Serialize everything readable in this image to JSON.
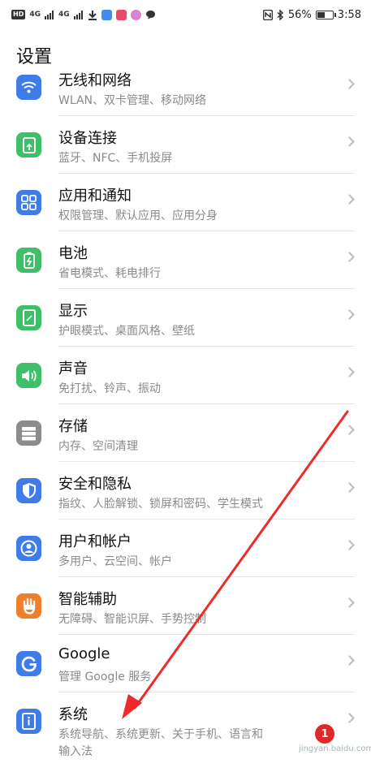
{
  "statusbar": {
    "left_chip": "HD",
    "net1": "4G",
    "net2": "4G",
    "battery": "56%",
    "time": "3:58",
    "battery_fraction": 0.56
  },
  "page": {
    "title": "设置"
  },
  "items": [
    {
      "title": "无线和网络",
      "subtitle": "WLAN、双卡管理、移动网络",
      "icon": "wifi-icon",
      "color": "#3f7ce8"
    },
    {
      "title": "设备连接",
      "subtitle": "蓝牙、NFC、手机投屏",
      "icon": "device-connect-icon",
      "color": "#3fbf6a"
    },
    {
      "title": "应用和通知",
      "subtitle": "权限管理、默认应用、应用分身",
      "icon": "apps-icon",
      "color": "#3f7ce8"
    },
    {
      "title": "电池",
      "subtitle": "省电模式、耗电排行",
      "icon": "battery-icon",
      "color": "#3fbf6a"
    },
    {
      "title": "显示",
      "subtitle": "护眼模式、桌面风格、壁纸",
      "icon": "display-icon",
      "color": "#3fbf6a"
    },
    {
      "title": "声音",
      "subtitle": "免打扰、铃声、振动",
      "icon": "sound-icon",
      "color": "#3fbf6a"
    },
    {
      "title": "存储",
      "subtitle": "内存、空间清理",
      "icon": "storage-icon",
      "color": "#8c8c8c"
    },
    {
      "title": "安全和隐私",
      "subtitle": "指纹、人脸解锁、锁屏和密码、学生模式",
      "icon": "shield-icon",
      "color": "#3f7ce8"
    },
    {
      "title": "用户和帐户",
      "subtitle": "多用户、云空间、帐户",
      "icon": "user-icon",
      "color": "#3f7ce8"
    },
    {
      "title": "智能辅助",
      "subtitle": "无障碍、智能识屏、手势控制",
      "icon": "hand-icon",
      "color": "#f07f2a"
    },
    {
      "title": "Google",
      "subtitle": "管理 Google 服务",
      "icon": "google-icon",
      "color": "#3f7ce8"
    },
    {
      "title": "系统",
      "subtitle": "系统导航、系统更新、关于手机、语言和",
      "subtitle2": "输入法",
      "icon": "system-icon",
      "color": "#3f7ce8",
      "badge": "1"
    }
  ],
  "watermark": "jingyan.baidu.com"
}
